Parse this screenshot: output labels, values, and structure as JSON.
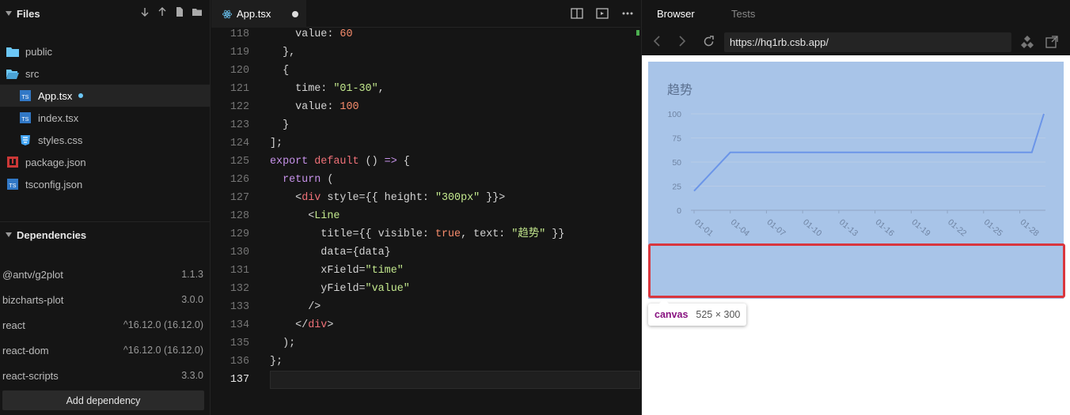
{
  "sidebar": {
    "files_title": "Files",
    "files": [
      {
        "name": "public",
        "icon": "folder-icon"
      },
      {
        "name": "src",
        "icon": "folder-open-icon"
      },
      {
        "name": "App.tsx",
        "icon": "ts-file-icon"
      },
      {
        "name": "index.tsx",
        "icon": "ts-file-icon"
      },
      {
        "name": "styles.css",
        "icon": "css-file-icon"
      },
      {
        "name": "package.json",
        "icon": "npm-icon"
      },
      {
        "name": "tsconfig.json",
        "icon": "ts-file-icon"
      }
    ],
    "deps_title": "Dependencies",
    "dependencies": [
      {
        "name": "@antv/g2plot",
        "version": "1.1.3"
      },
      {
        "name": "bizcharts-plot",
        "version": "3.0.0"
      },
      {
        "name": "react",
        "version": "^16.12.0 (16.12.0)"
      },
      {
        "name": "react-dom",
        "version": "^16.12.0 (16.12.0)"
      },
      {
        "name": "react-scripts",
        "version": "3.3.0"
      }
    ],
    "add_dependency": "Add dependency"
  },
  "editor": {
    "tab_label": "App.tsx",
    "current_line": "137"
  },
  "browser": {
    "tab_browser": "Browser",
    "tab_tests": "Tests",
    "url": "https://hq1rb.csb.app/",
    "chart_title": "趋势",
    "tooltip_tag": "canvas",
    "tooltip_dims": "525 × 300"
  },
  "colors": {
    "accent_line": "#6b95e8",
    "chart_bg": "#a8c4e8",
    "highlight_box": "#d9363e",
    "unsaved_dot": "#6cc7f6"
  },
  "chart_data": {
    "type": "line",
    "title": "趋势",
    "x": [
      "01-01",
      "01-04",
      "01-30"
    ],
    "tick_labels": [
      "01-01",
      "01-04",
      "01-07",
      "01-10",
      "01-13",
      "01-16",
      "01-19",
      "01-22",
      "01-25",
      "01-28"
    ],
    "y_ticks": [
      "0",
      "25",
      "50",
      "75",
      "100"
    ],
    "ylim": [
      0,
      100
    ],
    "series": [
      {
        "values_by_day": [
          [
            1,
            20
          ],
          [
            4,
            60
          ],
          [
            29,
            60
          ],
          [
            30,
            100
          ]
        ]
      }
    ]
  }
}
